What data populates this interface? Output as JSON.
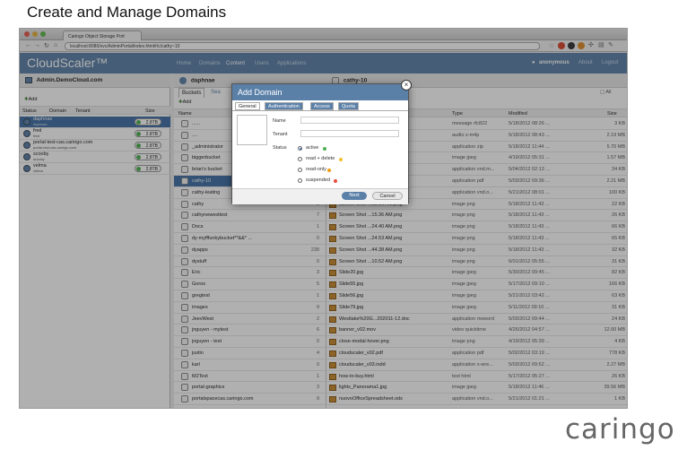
{
  "slide": {
    "title": "Create and Manage Domains",
    "logo": "caringo"
  },
  "browser": {
    "tab_label": "Caringo Object Storage Port",
    "url": "localhost:8080/svc/AdminPortal/index.html#/c/cathy~10"
  },
  "app": {
    "brand": "CloudScaler™",
    "nav": [
      "Home",
      "Domains",
      "Content",
      "Users",
      "Applications"
    ],
    "nav_active": "Content",
    "user": "anonymous",
    "links": [
      "About",
      "Logout"
    ],
    "accent": "#5b80a8"
  },
  "left": {
    "title": "Admin.DemoCloud.com",
    "add_label": "Add",
    "columns": [
      "Status",
      "Domain",
      "Tenant",
      "Size"
    ],
    "rows": [
      {
        "name": "daphnae",
        "sub": "daphnae",
        "size": "2.8TB",
        "selected": true
      },
      {
        "name": "fred",
        "sub": "fred",
        "size": "2.8TB",
        "selected": false
      },
      {
        "name": "portal-test-cas.caringo.com",
        "sub": "portal-test-cas.caringo.com",
        "size": "2.8TB",
        "selected": false
      },
      {
        "name": "scooby",
        "sub": "scooby",
        "size": "2.8TB",
        "selected": false
      },
      {
        "name": "velma",
        "sub": "velma",
        "size": "2.8TB",
        "selected": false
      }
    ]
  },
  "middle": {
    "title": "daphnae",
    "tabs": [
      "Buckets",
      "Sea"
    ],
    "add_label": "Add",
    "col_name": "Name",
    "rows": [
      {
        "name": "......",
        "count": ""
      },
      {
        "name": "....",
        "count": ""
      },
      {
        "name": "_administrator",
        "count": ""
      },
      {
        "name": "biggerbucket",
        "count": ""
      },
      {
        "name": "brian's bucket",
        "count": ""
      },
      {
        "name": "cathy-10",
        "count": "",
        "selected": true
      },
      {
        "name": "cathy-leating",
        "count": ""
      },
      {
        "name": "cathy",
        "count": "0"
      },
      {
        "name": "cathynewesttest",
        "count": "7"
      },
      {
        "name": "Docs",
        "count": "1"
      },
      {
        "name": "dy-myfffunkybucket**&&* ...",
        "count": "0"
      },
      {
        "name": "dyapps",
        "count": "238"
      },
      {
        "name": "dystuff",
        "count": "0"
      },
      {
        "name": "Eric",
        "count": "3"
      },
      {
        "name": "Goros",
        "count": "5"
      },
      {
        "name": "gregtest",
        "count": "1"
      },
      {
        "name": "images",
        "count": "9"
      },
      {
        "name": "JeevWest",
        "count": "2"
      },
      {
        "name": "jnguyen - mytest",
        "count": "6"
      },
      {
        "name": "jnguyen - test",
        "count": "0"
      },
      {
        "name": "justin",
        "count": "4"
      },
      {
        "name": "karl",
        "count": "0"
      },
      {
        "name": "M2Test",
        "count": "1"
      },
      {
        "name": "portal-graphics",
        "count": "3"
      },
      {
        "name": "portalspacecas.caringo.com",
        "count": "9"
      }
    ]
  },
  "right": {
    "title": "cathy-10",
    "all_label": "All",
    "columns": [
      "Type",
      "Modified",
      "Size"
    ],
    "rows": [
      {
        "name": "",
        "type": "message rfc822",
        "modified": "5/18/2012 08:26 ...",
        "size": "3 KB"
      },
      {
        "name": "",
        "type": "audio x-m4p",
        "modified": "5/18/2012 08:43 ...",
        "size": "2.19 MB"
      },
      {
        "name": "",
        "type": "application zip",
        "modified": "5/18/2012 11:44 ...",
        "size": "5.70 MB"
      },
      {
        "name": "",
        "type": "image jpeg",
        "modified": "4/19/2012 05:31 ...",
        "size": "1.57 MB"
      },
      {
        "name": "",
        "type": "application vnd.m...",
        "modified": "5/04/2012 02:13 ...",
        "size": "34 KB"
      },
      {
        "name": "",
        "type": "application pdf",
        "modified": "5/03/2012 09:36 ...",
        "size": "2.21 MB"
      },
      {
        "name": "",
        "type": "application vnd.o...",
        "modified": "5/21/2012 08:01 ...",
        "size": "100 KB"
      },
      {
        "name": "Screen Shot ...15.16 AM.png",
        "type": "image png",
        "modified": "5/18/2012 11:43 ...",
        "size": "22 KB"
      },
      {
        "name": "Screen Shot ...15.36 AM.png",
        "type": "image png",
        "modified": "5/18/2012 11:43 ...",
        "size": "26 KB"
      },
      {
        "name": "Screen Shot ...24.40 AM.png",
        "type": "image png",
        "modified": "5/18/2012 11:43 ...",
        "size": "66 KB"
      },
      {
        "name": "Screen Shot ...24.53 AM.png",
        "type": "image png",
        "modified": "5/18/2012 11:43 ...",
        "size": "65 KB"
      },
      {
        "name": "Screen Shot ...44.38 AM.png",
        "type": "image png",
        "modified": "5/18/2012 11:43 ...",
        "size": "32 KB"
      },
      {
        "name": "Screen Shot ...10.52 AM.png",
        "type": "image png",
        "modified": "6/01/2012 05:55 ...",
        "size": "31 KB"
      },
      {
        "name": "Slide20.jpg",
        "type": "image jpeg",
        "modified": "5/30/2012 09:45 ...",
        "size": "82 KB"
      },
      {
        "name": "Slide55.jpg",
        "type": "image jpeg",
        "modified": "5/17/2012 09:10 ...",
        "size": "166 KB"
      },
      {
        "name": "Slide56.jpg",
        "type": "image jpeg",
        "modified": "5/21/2012 03:42 ...",
        "size": "63 KB"
      },
      {
        "name": "Slide79.jpg",
        "type": "image jpeg",
        "modified": "5/11/2012 09:10 ...",
        "size": "31 KB"
      },
      {
        "name": "Westlake%20G...202011-12.doc",
        "type": "application msword",
        "modified": "5/03/2012 09:44 ...",
        "size": "24 KB"
      },
      {
        "name": "banner_v02.mov",
        "type": "video quicktime",
        "modified": "4/26/2012 04:57 ...",
        "size": "12.00 MB"
      },
      {
        "name": "close-modal-hover.png",
        "type": "image png",
        "modified": "4/19/2012 05:39 ...",
        "size": "4 KB"
      },
      {
        "name": "cloudscaler_v02.pdf",
        "type": "application pdf",
        "modified": "5/02/2012 03:19 ...",
        "size": "778 KB"
      },
      {
        "name": "cloudscaler_v03.indd",
        "type": "application x-wre...",
        "modified": "5/03/2012 09:52 ...",
        "size": "2.27 MB"
      },
      {
        "name": "how-to-buy.html",
        "type": "text html",
        "modified": "5/17/2012 05:27 ...",
        "size": "26 KB"
      },
      {
        "name": "lights_Panorama1.jpg",
        "type": "image jpeg",
        "modified": "5/18/2012 11:46 ...",
        "size": "39.56 MB"
      },
      {
        "name": "nuovoOfficeSpreadsheet.ods",
        "type": "application vnd.o...",
        "modified": "5/21/2012 01:21 ...",
        "size": "1 KB"
      }
    ]
  },
  "modal": {
    "title": "Add Domain",
    "tabs": [
      "General",
      "Authentication",
      "Access",
      "Quota"
    ],
    "name_label": "Name",
    "tenant_label": "Tenant",
    "status_label": "Status",
    "status_options": [
      "active",
      "read + delete",
      "read-only",
      "suspended"
    ],
    "status_selected": "active",
    "next_label": "Next",
    "cancel_label": "Cancel"
  }
}
